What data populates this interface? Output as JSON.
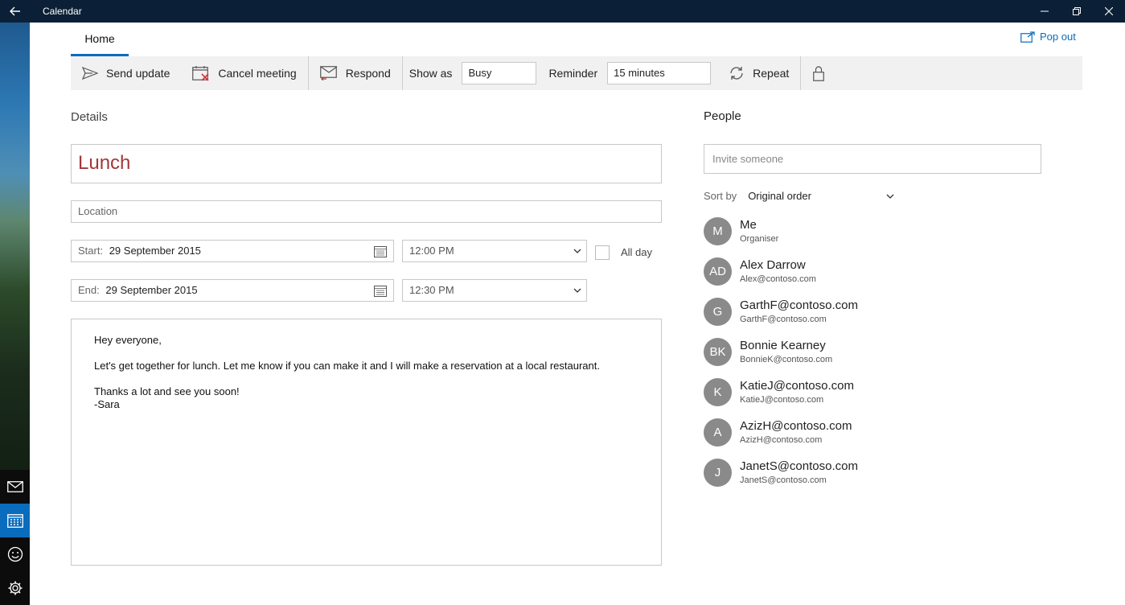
{
  "window": {
    "title": "Calendar"
  },
  "tabs": {
    "home": "Home",
    "popout": "Pop out"
  },
  "toolbar": {
    "send_update": "Send update",
    "cancel_meeting": "Cancel meeting",
    "respond": "Respond",
    "show_as_label": "Show as",
    "show_as_value": "Busy",
    "reminder_label": "Reminder",
    "reminder_value": "15 minutes",
    "repeat": "Repeat"
  },
  "details": {
    "heading": "Details",
    "subject": "Lunch",
    "location_placeholder": "Location",
    "start_label": "Start:",
    "start_date": "29 September 2015",
    "start_time": "12:00 PM",
    "end_label": "End:",
    "end_date": "29 September 2015",
    "end_time": "12:30 PM",
    "all_day_label": "All day",
    "all_day_checked": false,
    "body_lines": [
      "Hey everyone,",
      "Let's get together for lunch. Let me know if you can make it and I will make a reservation at a local restaurant.",
      "Thanks a lot and see you soon!",
      "-Sara"
    ]
  },
  "people": {
    "heading": "People",
    "invite_placeholder": "Invite someone",
    "sort_label": "Sort by",
    "sort_value": "Original order",
    "list": [
      {
        "initials": "M",
        "name": "Me",
        "sub": "Organiser"
      },
      {
        "initials": "AD",
        "name": "Alex Darrow",
        "sub": "Alex@contoso.com"
      },
      {
        "initials": "G",
        "name": "GarthF@contoso.com",
        "sub": "GarthF@contoso.com"
      },
      {
        "initials": "BK",
        "name": "Bonnie Kearney",
        "sub": "BonnieK@contoso.com"
      },
      {
        "initials": "K",
        "name": "KatieJ@contoso.com",
        "sub": "KatieJ@contoso.com"
      },
      {
        "initials": "A",
        "name": "AzizH@contoso.com",
        "sub": "AzizH@contoso.com"
      },
      {
        "initials": "J",
        "name": "JanetS@contoso.com",
        "sub": "JanetS@contoso.com"
      }
    ]
  },
  "icons": {
    "back": "back-arrow-icon",
    "minimize": "minimize-icon",
    "restore": "restore-icon",
    "close": "close-icon",
    "mail": "mail-icon",
    "calendar": "calendar-icon",
    "feedback": "smiley-icon",
    "settings": "gear-icon",
    "lock": "lock-icon"
  },
  "colors": {
    "accent": "#0a6cbd",
    "titlebar": "#0b2036",
    "subject": "#a4373a",
    "avatar": "#8a8a8a"
  }
}
